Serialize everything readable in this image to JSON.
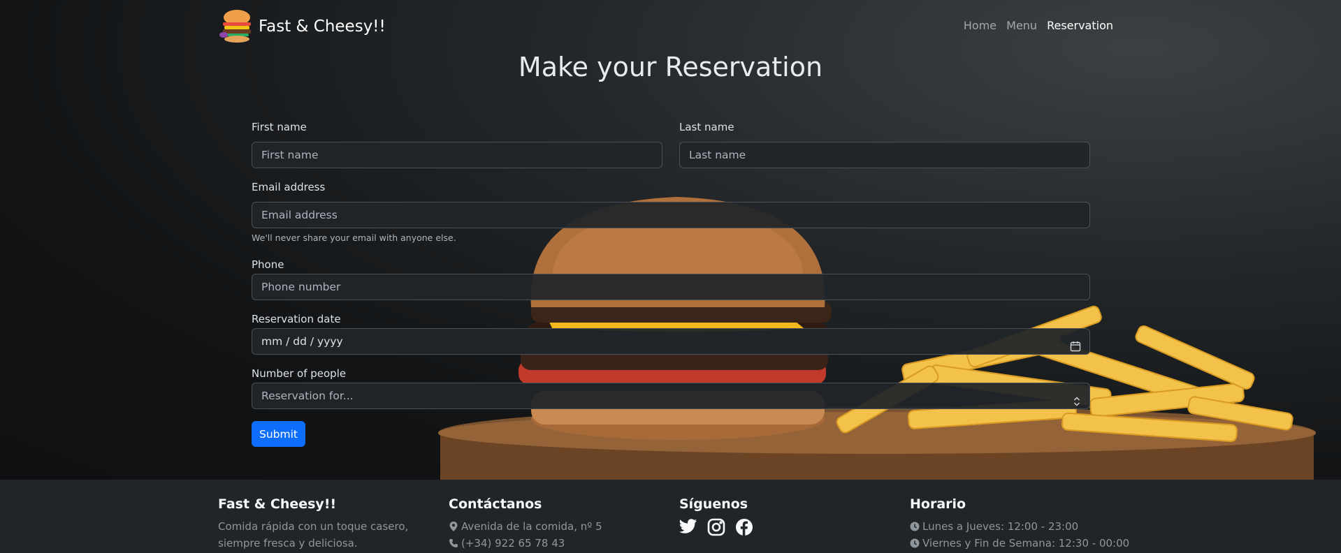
{
  "navbar": {
    "brand": "Fast & Cheesy!!",
    "links": [
      {
        "label": "Home",
        "active": false
      },
      {
        "label": "Menu",
        "active": false
      },
      {
        "label": "Reservation",
        "active": true
      }
    ]
  },
  "page": {
    "title": "Make your Reservation"
  },
  "form": {
    "first_name": {
      "label": "First name",
      "placeholder": "First name"
    },
    "last_name": {
      "label": "Last name",
      "placeholder": "Last name"
    },
    "email": {
      "label": "Email address",
      "placeholder": "Email address",
      "help": "We'll never share your email with anyone else."
    },
    "phone": {
      "label": "Phone",
      "placeholder": "Phone number"
    },
    "date": {
      "label": "Reservation date",
      "value": "mm / dd / yyyy"
    },
    "people": {
      "label": "Number of people",
      "selected": "Reservation for..."
    },
    "submit_label": "Submit"
  },
  "footer": {
    "about": {
      "title": "Fast & Cheesy!!",
      "text_line1": "Comida rápida con un toque casero,",
      "text_line2": "siempre fresca y deliciosa."
    },
    "contact": {
      "title": "Contáctanos",
      "address": "Avenida de la comida, nº 5",
      "phone": "(+34) 922 65 78 43"
    },
    "social": {
      "title": "Síguenos",
      "icons": [
        "twitter-icon",
        "instagram-icon",
        "facebook-icon"
      ]
    },
    "hours": {
      "title": "Horario",
      "weekdays": "Lunes a Jueves: 12:00 - 23:00",
      "weekend": "Viernes y Fin de Semana: 12:30 - 00:00"
    }
  },
  "colors": {
    "accent": "#0d6efd",
    "footer_bg": "#212529",
    "hero_bg": "#16181b"
  }
}
